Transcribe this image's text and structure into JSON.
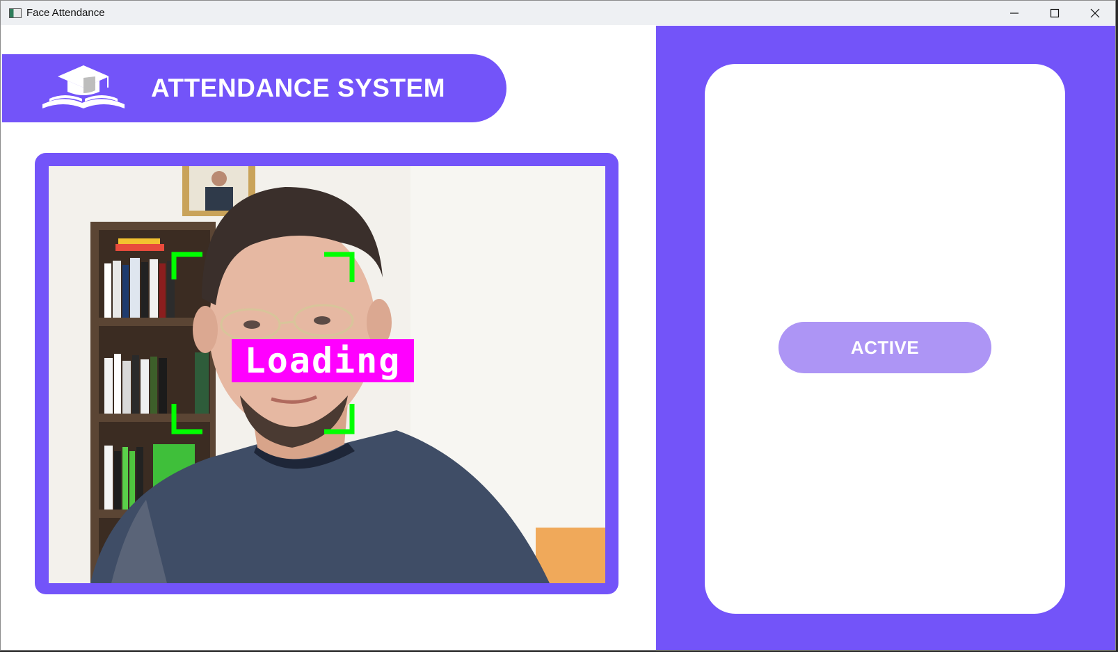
{
  "window": {
    "title": "Face Attendance",
    "controls": [
      "minimize-icon",
      "maximize-icon",
      "close-icon"
    ]
  },
  "header": {
    "logo_icon": "graduation-cap-book-icon",
    "title": "ATTENDANCE SYSTEM"
  },
  "camera": {
    "overlay_label": "Loading",
    "overlay_color": "#ff00ff",
    "face_bracket_color": "#00ff00"
  },
  "status": {
    "label": "ACTIVE"
  },
  "colors": {
    "accent": "#7354f9",
    "status_pill": "#ad95f5",
    "background": "#ffffff"
  }
}
